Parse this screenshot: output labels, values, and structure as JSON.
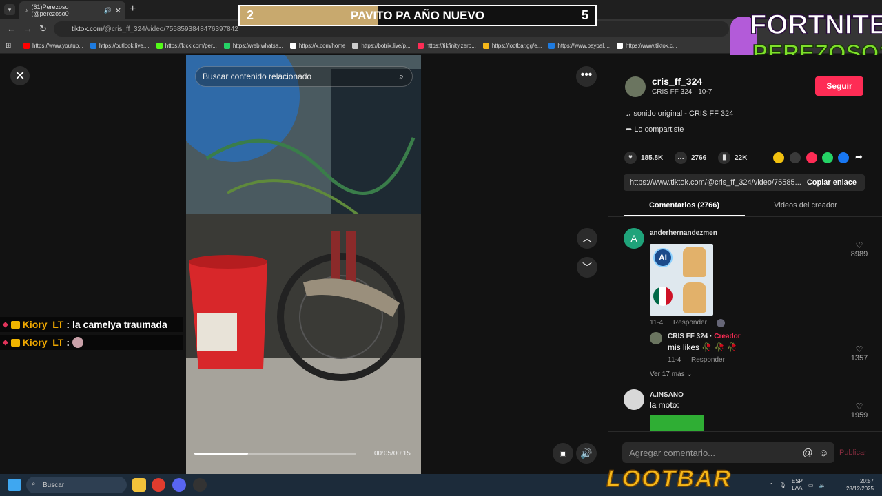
{
  "browser": {
    "tab_title": "(61)Perezoso (@perezoso0",
    "url_host": "tiktok.com",
    "url_path": "/@cris_ff_324/video/7558593848476397842",
    "bookmarks": [
      "https://www.youtub...",
      "https://outlook.live....",
      "https://kick.com/per...",
      "https://web.whatsa...",
      "https://x.com/home",
      "https://botrix.live/p...",
      "https://tikfinity.zero...",
      "https://lootbar.gg/e...",
      "https://www.paypal....",
      "https://www.tiktok.c..."
    ],
    "bookmark_colors": [
      "#ff0000",
      "#1e7be0",
      "#53fc18",
      "#25d366",
      "#ffffff",
      "#cccccc",
      "#fe2c55",
      "#f6b81a",
      "#1e7be0",
      "#ffffff"
    ]
  },
  "overlay": {
    "score_left": "2",
    "score_title": "PAVITO PA AÑO NUEVO",
    "score_right": "5",
    "score_progress": 0.39,
    "brand_top": "FORTNITE",
    "brand_bottom": "PEREZOSO1"
  },
  "chat": [
    {
      "user": "Kiory_LT",
      "sep": ":",
      "message": "la camelya traumada"
    },
    {
      "user": "Kiory_LT",
      "sep": ":",
      "message": ""
    }
  ],
  "video": {
    "search_placeholder": "Buscar contenido relacionado",
    "time": "00:05/00:15",
    "progress": 0.33
  },
  "creator": {
    "username": "cris_ff_324",
    "subtitle": "CRIS FF 324 · 10-7",
    "follow_label": "Seguir",
    "sound": "sonido original - CRIS FF 324",
    "shared": "Lo compartiste"
  },
  "stats": {
    "likes": "185.8K",
    "comments": "2766",
    "saves": "22K"
  },
  "share_colors": [
    "#f2c10f",
    "#3a3a3a",
    "#fe2c55",
    "#25d366",
    "#1877f2"
  ],
  "link": {
    "url": "https://www.tiktok.com/@cris_ff_324/video/75585...",
    "copy_label": "Copiar enlace"
  },
  "tabs": {
    "comments": "Comentarios (2766)",
    "videos": "Videos del creador"
  },
  "comments": [
    {
      "avatar_letter": "A",
      "user": "anderhernandezmen",
      "date": "11-4",
      "reply_label": "Responder",
      "likes": "8989",
      "reply": {
        "user": "CRIS FF 324",
        "creator_tag": "Creador",
        "text": "mis likes 🥀 🥀 🥀",
        "date": "11-4",
        "reply_label": "Responder",
        "likes": "1357"
      },
      "more": "Ver 17 más"
    },
    {
      "user": "A.INSANO",
      "text": "la moto:",
      "likes": "1959"
    }
  ],
  "composer": {
    "placeholder": "Agregar comentario...",
    "publish": "Publicar"
  },
  "taskbar": {
    "search": "Buscar",
    "sponsor": "LOOTBAR",
    "lang_top": "ESP",
    "lang_bottom": "LAA",
    "time": "20:57",
    "date": "28/12/2025"
  }
}
